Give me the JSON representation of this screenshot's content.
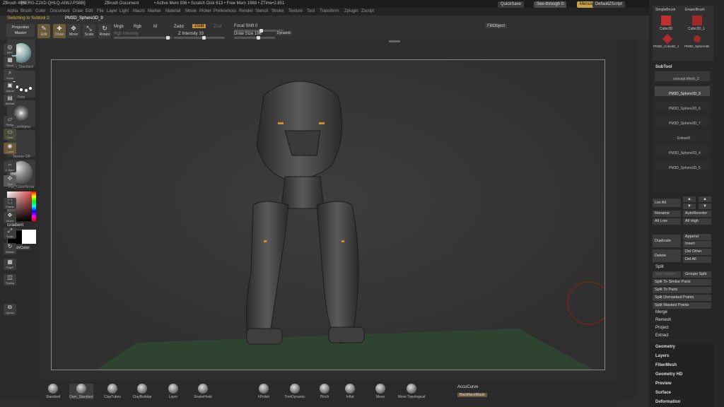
{
  "title_bar": {
    "app": "ZBrush 4R5",
    "version": "[VERG-ZJXD-QHLQ-AIWJ-PSBB]",
    "document": "ZBrush Document",
    "mem": "• Active Mem 936 • Scratch Disk 613 • Free Mem 1988 • ZTime•2.851",
    "quicksave": "QuickSave",
    "seethrough": "See-through 0",
    "menus": "Menus",
    "script": "DefaultZScript"
  },
  "menu_bar": [
    "Alpha",
    "Brush",
    "Color",
    "Document",
    "Draw",
    "Edit",
    "File",
    "Layer",
    "Light",
    "Macro",
    "Marker",
    "Material",
    "Movie",
    "Picker",
    "Preferences",
    "Render",
    "Stencil",
    "Stroke",
    "Texture",
    "Tool",
    "Transform",
    "Zplugin",
    "Zscript"
  ],
  "status": {
    "label": "Switching to Subtool 2:",
    "value": "PM3D_Sphere3D_9"
  },
  "toolbar": {
    "projection_master": "Projection Master",
    "tools": [
      {
        "label": "Edit",
        "icon": "edit-icon",
        "glyph": "✎"
      },
      {
        "label": "Draw",
        "icon": "draw-icon",
        "glyph": "✚"
      },
      {
        "label": "Move",
        "icon": "move-icon",
        "glyph": "✥"
      },
      {
        "label": "Scale",
        "icon": "scale-icon",
        "glyph": "⤡"
      },
      {
        "label": "Rotate",
        "icon": "rotate-icon",
        "glyph": "↻"
      }
    ],
    "mrgb": "Mrgb",
    "rgb": "Rgb",
    "m": "M",
    "rgb_intensity": "Rgb Intensity",
    "zadd": "Zadd",
    "zsub": "Zsub",
    "zcut": "Zcut",
    "z_intensity": "Z Intensity 33",
    "focal_shift": "Focal Shift 0",
    "draw_size": "Draw Size 198",
    "dynamic": "Dynamic",
    "fill_object": "FillObject"
  },
  "left_shelf": {
    "items": [
      "Dam_Standard",
      "Dots",
      "BrushAlpha",
      "Texture Off",
      "Flat_Color/Snow"
    ],
    "gradient": "Gradient",
    "switch_color": "SwitchColor"
  },
  "right_shelf": [
    "BPR",
    "Scroll",
    "Zoom",
    "Actual",
    "AAHalf",
    "Persp",
    "Floor",
    "Local",
    "L.Sym",
    "Xyz",
    "Frame",
    "Move",
    "Scale",
    "Rotate",
    "PolyF",
    "Transp",
    "Ghost",
    "Solo",
    "Xpose"
  ],
  "brush_palette": {
    "items": [
      "SimpleBrush",
      "EraserBrush",
      "Cube3D",
      "Cube3D_1",
      "PM3D_Cube3D_1",
      "PM3D_Sphere3D"
    ]
  },
  "subtool": {
    "header": "SubTool",
    "items": [
      "concept Mesh_2",
      "PM3D_Sphere3D_9",
      "PM3D_Sphere3D_6",
      "PM3D_Sphere3D_7",
      "Extract0",
      "PM3D_Sphere3D_4",
      "PM3D_Sphere3D_5"
    ],
    "list_all": "List All",
    "rename": "Rename",
    "auto_reorder": "AutoReorder",
    "all_low": "All Low",
    "all_high": "All High",
    "duplicate": "Duplicate",
    "append": "Append",
    "insert": "Insert",
    "delete": "Delete",
    "del_other": "Del Other",
    "del_all": "Del All",
    "split": "Split",
    "split_hidden": "Split Hidden",
    "groups_split": "Groups Split",
    "split_similar": "Split To Similar Parts",
    "split_parts": "Split To Parts",
    "split_unmasked": "Split Unmasked Points",
    "split_masked": "Split Masked Points",
    "merge": "Merge",
    "remesh": "Remesh",
    "project": "Project",
    "extract": "Extract"
  },
  "panels": [
    "Geometry",
    "Layers",
    "FiberMesh",
    "Geometry HD",
    "Preview",
    "Surface",
    "Deformation"
  ],
  "bottom_brushes": [
    "Standard",
    "Dam_Standard",
    "ClayTubes",
    "ClayBuildup",
    "Layer",
    "SnakeHook",
    "hPolish",
    "TrimDynamic",
    "Pinch",
    "Inflat",
    "Move",
    "Move Topological"
  ],
  "accucurve": "AccuCurve",
  "backface": "BackfaceMask"
}
